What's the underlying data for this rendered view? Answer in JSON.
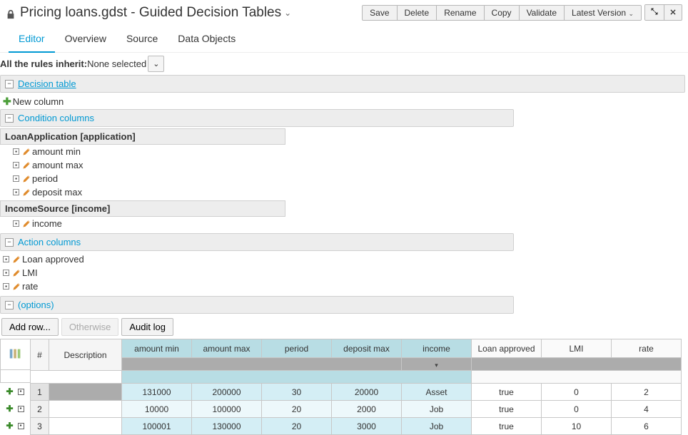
{
  "header": {
    "title": "Pricing loans.gdst - Guided Decision Tables",
    "actions": {
      "save": "Save",
      "delete": "Delete",
      "rename": "Rename",
      "copy": "Copy",
      "validate": "Validate",
      "version": "Latest Version"
    }
  },
  "tabs": {
    "editor": "Editor",
    "overview": "Overview",
    "source": "Source",
    "data_objects": "Data Objects"
  },
  "inherit": {
    "label": "All the rules inherit:",
    "value": "None selected"
  },
  "panels": {
    "decision_table": "Decision table",
    "new_column": "New column",
    "condition_columns": "Condition columns",
    "action_columns": "Action columns",
    "options": "(options)"
  },
  "facts": {
    "loan_app": {
      "heading": "LoanApplication [application]",
      "fields": [
        "amount min",
        "amount max",
        "period",
        "deposit max"
      ]
    },
    "income": {
      "heading": "IncomeSource [income]",
      "fields": [
        "income"
      ]
    }
  },
  "actions": {
    "items": [
      "Loan approved",
      "LMI",
      "rate"
    ]
  },
  "bottom_buttons": {
    "add_row": "Add row...",
    "otherwise": "Otherwise",
    "audit_log": "Audit log"
  },
  "grid": {
    "headers": {
      "num": "#",
      "desc": "Description",
      "conditions": [
        "amount min",
        "amount max",
        "period",
        "deposit max",
        "income"
      ],
      "actions": [
        "Loan approved",
        "LMI",
        "rate"
      ]
    },
    "rows": [
      {
        "n": "1",
        "desc": "",
        "c": [
          "131000",
          "200000",
          "30",
          "20000",
          "Asset"
        ],
        "a": [
          "true",
          "0",
          "2"
        ]
      },
      {
        "n": "2",
        "desc": "",
        "c": [
          "10000",
          "100000",
          "20",
          "2000",
          "Job"
        ],
        "a": [
          "true",
          "0",
          "4"
        ]
      },
      {
        "n": "3",
        "desc": "",
        "c": [
          "100001",
          "130000",
          "20",
          "3000",
          "Job"
        ],
        "a": [
          "true",
          "10",
          "6"
        ]
      }
    ]
  }
}
